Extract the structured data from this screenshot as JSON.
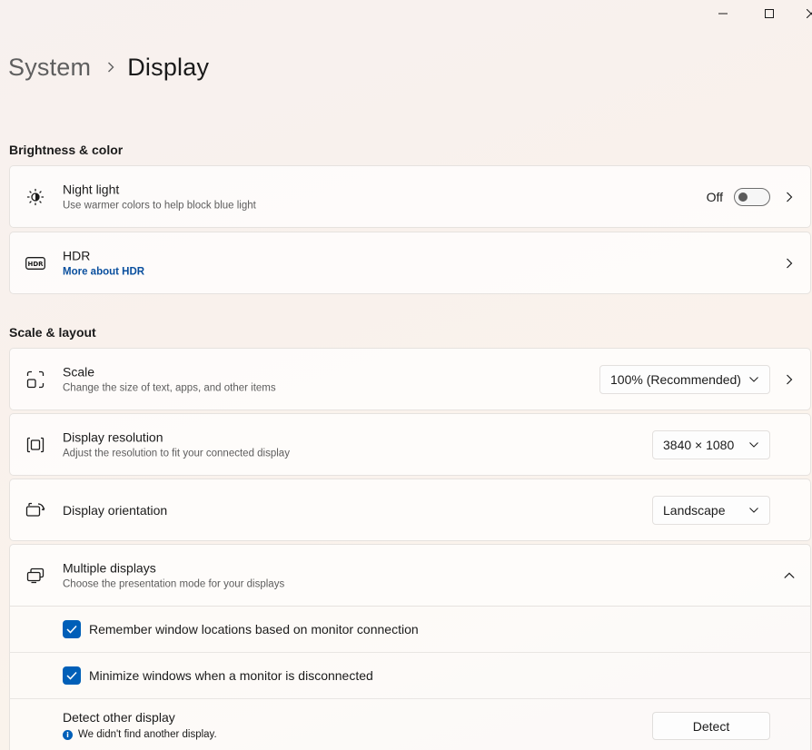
{
  "window": {
    "minimize_icon": "minimize-icon",
    "maximize_icon": "maximize-icon",
    "close_icon": "close-icon"
  },
  "breadcrumb": {
    "parent": "System",
    "separator_icon": "chevron-right-icon",
    "current": "Display"
  },
  "sections": {
    "brightness": "Brightness & color",
    "scale_layout": "Scale & layout"
  },
  "night_light": {
    "title": "Night light",
    "subtitle": "Use warmer colors to help block blue light",
    "state_label": "Off",
    "toggle_on": false,
    "icon": "brightness-icon"
  },
  "hdr": {
    "title": "HDR",
    "link": "More about HDR",
    "icon": "hdr-icon"
  },
  "scale": {
    "title": "Scale",
    "subtitle": "Change the size of text, apps, and other items",
    "value": "100% (Recommended)",
    "icon": "scale-icon"
  },
  "resolution": {
    "title": "Display resolution",
    "subtitle": "Adjust the resolution to fit your connected display",
    "value": "3840 × 1080",
    "icon": "resolution-icon"
  },
  "orientation": {
    "title": "Display orientation",
    "value": "Landscape",
    "icon": "orientation-icon"
  },
  "multiple_displays": {
    "title": "Multiple displays",
    "subtitle": "Choose the presentation mode for your displays",
    "icon": "multiple-displays-icon",
    "expanded": true,
    "options": [
      {
        "label": "Remember window locations based on monitor connection",
        "checked": true
      },
      {
        "label": "Minimize windows when a monitor is disconnected",
        "checked": true
      }
    ],
    "detect": {
      "title": "Detect other display",
      "info": "We didn't find another display.",
      "button": "Detect"
    }
  },
  "colors": {
    "accent": "#005fb8",
    "link": "#0a4f9e"
  }
}
